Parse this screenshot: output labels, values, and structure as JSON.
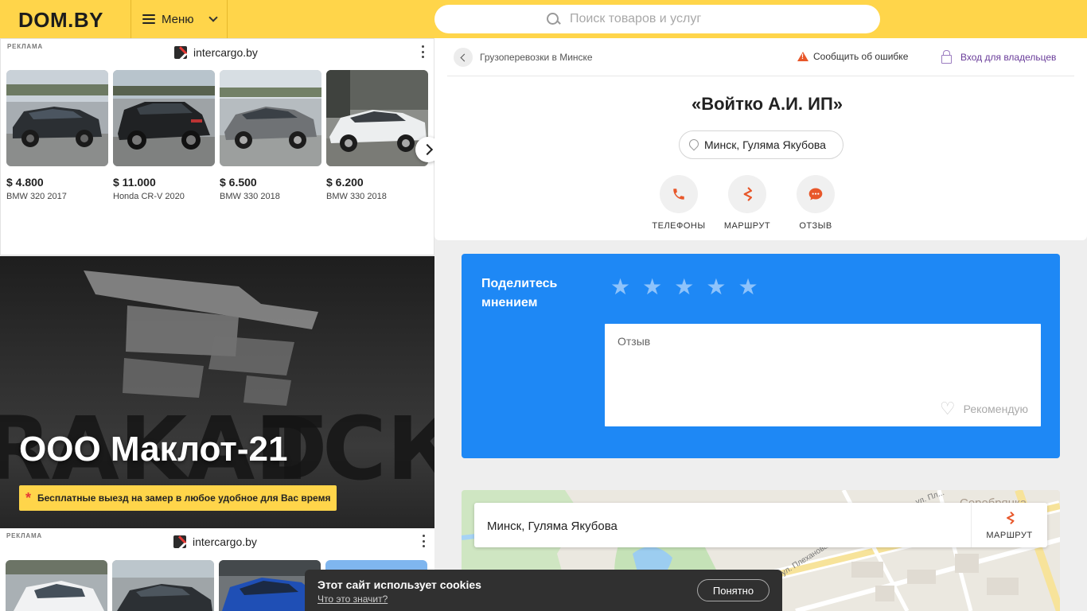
{
  "header": {
    "logo": "DOM.BY",
    "menu_label": "Меню",
    "search_placeholder": "Поиск товаров и услуг"
  },
  "ad_top": {
    "label": "РЕКЛАМА",
    "brand": "intercargo.by",
    "cars": [
      {
        "price": "$ 4.800",
        "model": "BMW 320 2017"
      },
      {
        "price": "$ 11.000",
        "model": "Honda CR-V 2020"
      },
      {
        "price": "$ 6.500",
        "model": "BMW 330 2018"
      },
      {
        "price": "$ 6.200",
        "model": "BMW 330 2018"
      }
    ]
  },
  "banner": {
    "title": "ООО Маклот-21",
    "badge": "Бесплатные выезд на замер в любое удобное для Вас время"
  },
  "ad_bottom": {
    "label": "РЕКЛАМА",
    "brand": "intercargo.by"
  },
  "card": {
    "breadcrumb": "Грузоперевозки в Минске",
    "report_error": "Сообщить об ошибке",
    "owner_login": "Вход для владельцев",
    "company_name": "«Войтко А.И. ИП»",
    "address": "Минск, Гуляма Якубова",
    "actions": [
      {
        "label": "ТЕЛЕФОНЫ",
        "icon": "phone-icon"
      },
      {
        "label": "МАРШРУТ",
        "icon": "route-icon"
      },
      {
        "label": "ОТЗЫВ",
        "icon": "chat-icon"
      }
    ]
  },
  "review": {
    "title": "Поделитесь мнением",
    "placeholder": "Отзыв",
    "recommend": "Рекомендую",
    "rating": 0
  },
  "map": {
    "address": "Минск, Гуляма Якубова",
    "route_label": "МАРШРУТ",
    "labels": [
      "Серебрянка",
      "ул. Плеханова",
      "ул. Пл..."
    ]
  },
  "cookie": {
    "text": "Этот сайт использует cookies",
    "link": "Что это значит?",
    "button": "Понятно"
  },
  "colors": {
    "header_bg": "#ffd54a",
    "accent_orange": "#e8572a",
    "review_blue": "#1e88f5",
    "owner_purple": "#6a3d9a"
  }
}
